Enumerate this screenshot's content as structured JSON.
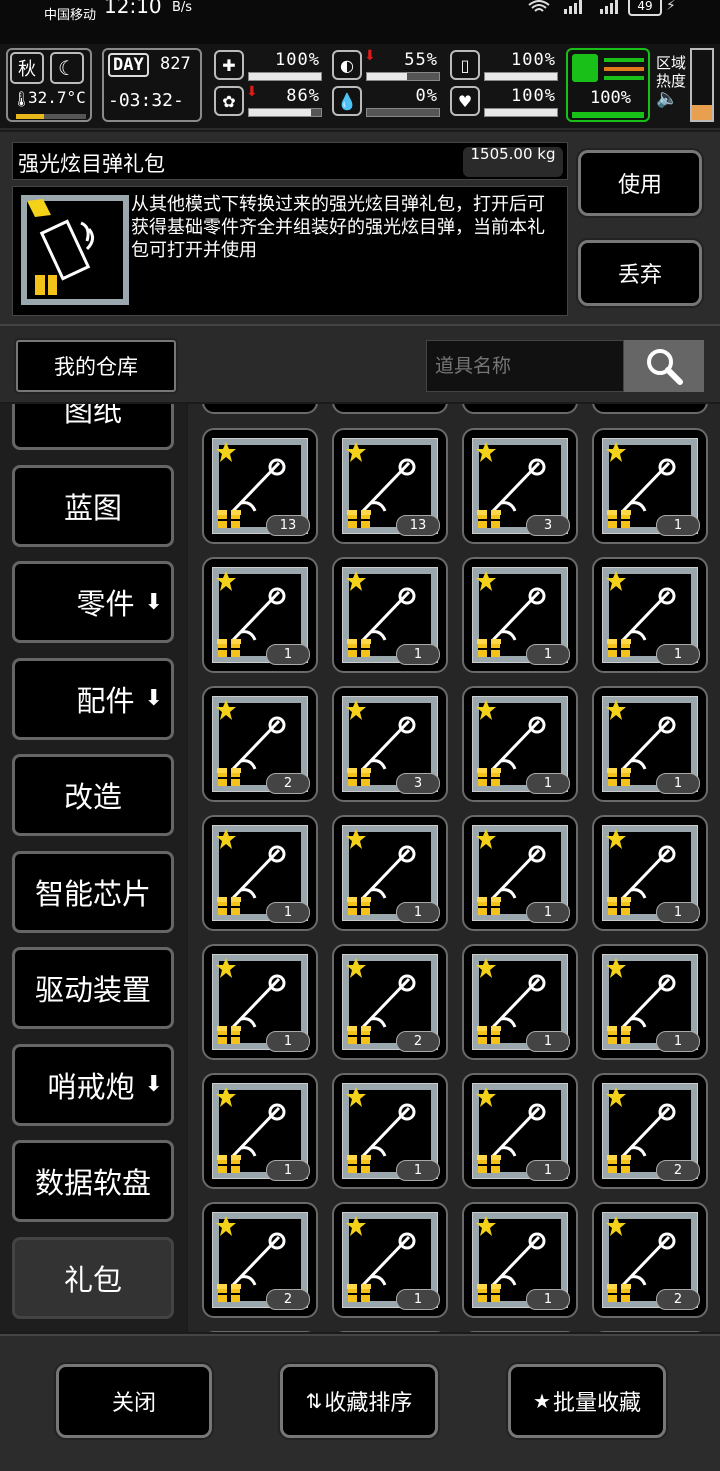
{
  "status_bar": {
    "carrier": "中国移动",
    "time": "12:10",
    "speed": "B/s",
    "battery": "49"
  },
  "hud": {
    "season": "秋",
    "temperature": "32.7°C",
    "day_label": "DAY",
    "day_number": "827",
    "clock": "-03:32-",
    "stats": [
      {
        "icon": "medkit-icon",
        "value": "100%",
        "fill": 1.0,
        "arrow": false
      },
      {
        "icon": "stomach-icon",
        "value": "55%",
        "fill": 0.55,
        "arrow": true
      },
      {
        "icon": "water-icon",
        "value": "100%",
        "fill": 1.0,
        "arrow": false
      },
      {
        "icon": "brain-icon",
        "value": "86%",
        "fill": 0.86,
        "arrow": true
      },
      {
        "icon": "blood-drop-icon",
        "value": "0%",
        "fill": 0.0,
        "arrow": false
      },
      {
        "icon": "heart-icon",
        "value": "100%",
        "fill": 1.0,
        "arrow": false
      }
    ],
    "stamina": "100%",
    "zone_label_1": "区域",
    "zone_label_2": "热度",
    "colors": {
      "accent_green": "#18c018",
      "warn_red": "#e01a1a",
      "orange": "#e07a1a"
    }
  },
  "detail": {
    "title": "强光炫目弹礼包",
    "weight": "1505.00 kg",
    "description": "从其他模式下转换过来的强光炫目弹礼包，打开后可获得基础零件齐全并组装好的强光炫目弹，当前本礼包可打开并使用",
    "use_label": "使用",
    "discard_label": "丢弃"
  },
  "search": {
    "warehouse_label": "我的仓库",
    "placeholder": "道具名称"
  },
  "categories": [
    {
      "label": "图纸",
      "arrow": false,
      "active": false
    },
    {
      "label": "蓝图",
      "arrow": false,
      "active": false
    },
    {
      "label": "零件",
      "arrow": true,
      "active": false
    },
    {
      "label": "配件",
      "arrow": true,
      "active": false
    },
    {
      "label": "改造",
      "arrow": false,
      "active": false
    },
    {
      "label": "智能芯片",
      "arrow": false,
      "active": false
    },
    {
      "label": "驱动装置",
      "arrow": false,
      "active": false
    },
    {
      "label": "哨戒炮",
      "arrow": true,
      "active": false
    },
    {
      "label": "数据软盘",
      "arrow": false,
      "active": false
    },
    {
      "label": "礼包",
      "arrow": false,
      "active": true
    }
  ],
  "items": [
    {
      "count": "13",
      "icon": "chainsaw-icon"
    },
    {
      "count": "13",
      "icon": "spear-icon"
    },
    {
      "count": "3",
      "icon": "airdrop-car-icon"
    },
    {
      "count": "1",
      "icon": "dinosaur-icon"
    },
    {
      "count": "1",
      "icon": "pants-icon"
    },
    {
      "count": "1",
      "icon": "rifle-icon"
    },
    {
      "count": "1",
      "icon": "chain-icon"
    },
    {
      "count": "1",
      "icon": "airdrop-motorbike-icon"
    },
    {
      "count": "2",
      "icon": "machine-gun-icon"
    },
    {
      "count": "3",
      "icon": "curved-blade-icon"
    },
    {
      "count": "1",
      "icon": "whip-icon"
    },
    {
      "count": "1",
      "icon": "ornate-gun-icon"
    },
    {
      "count": "1",
      "icon": "thorn-staff-icon"
    },
    {
      "count": "1",
      "icon": "dragon-mask-icon"
    },
    {
      "count": "1",
      "icon": "hot-air-balloon-icon"
    },
    {
      "count": "1",
      "icon": "armored-glove-icon"
    },
    {
      "count": "1",
      "icon": "fur-vest-icon"
    },
    {
      "count": "2",
      "icon": "sword-icon"
    },
    {
      "count": "1",
      "icon": "golden-hammer-icon"
    },
    {
      "count": "1",
      "icon": "pagoda-icon"
    },
    {
      "count": "1",
      "icon": "heavy-cannon-icon"
    },
    {
      "count": "1",
      "icon": "medusa-mask-icon"
    },
    {
      "count": "1",
      "icon": "duffel-bag-icon"
    },
    {
      "count": "2",
      "icon": "golden-gauntlet-icon"
    },
    {
      "count": "2",
      "icon": "coiled-rope-icon"
    },
    {
      "count": "1",
      "icon": "robe-icon"
    },
    {
      "count": "1",
      "icon": "sniper-rifle-icon"
    },
    {
      "count": "2",
      "icon": "helmet-icon"
    }
  ],
  "bottom": {
    "close_label": "关闭",
    "sort_label": "收藏排序",
    "batch_label": "批量收藏"
  }
}
